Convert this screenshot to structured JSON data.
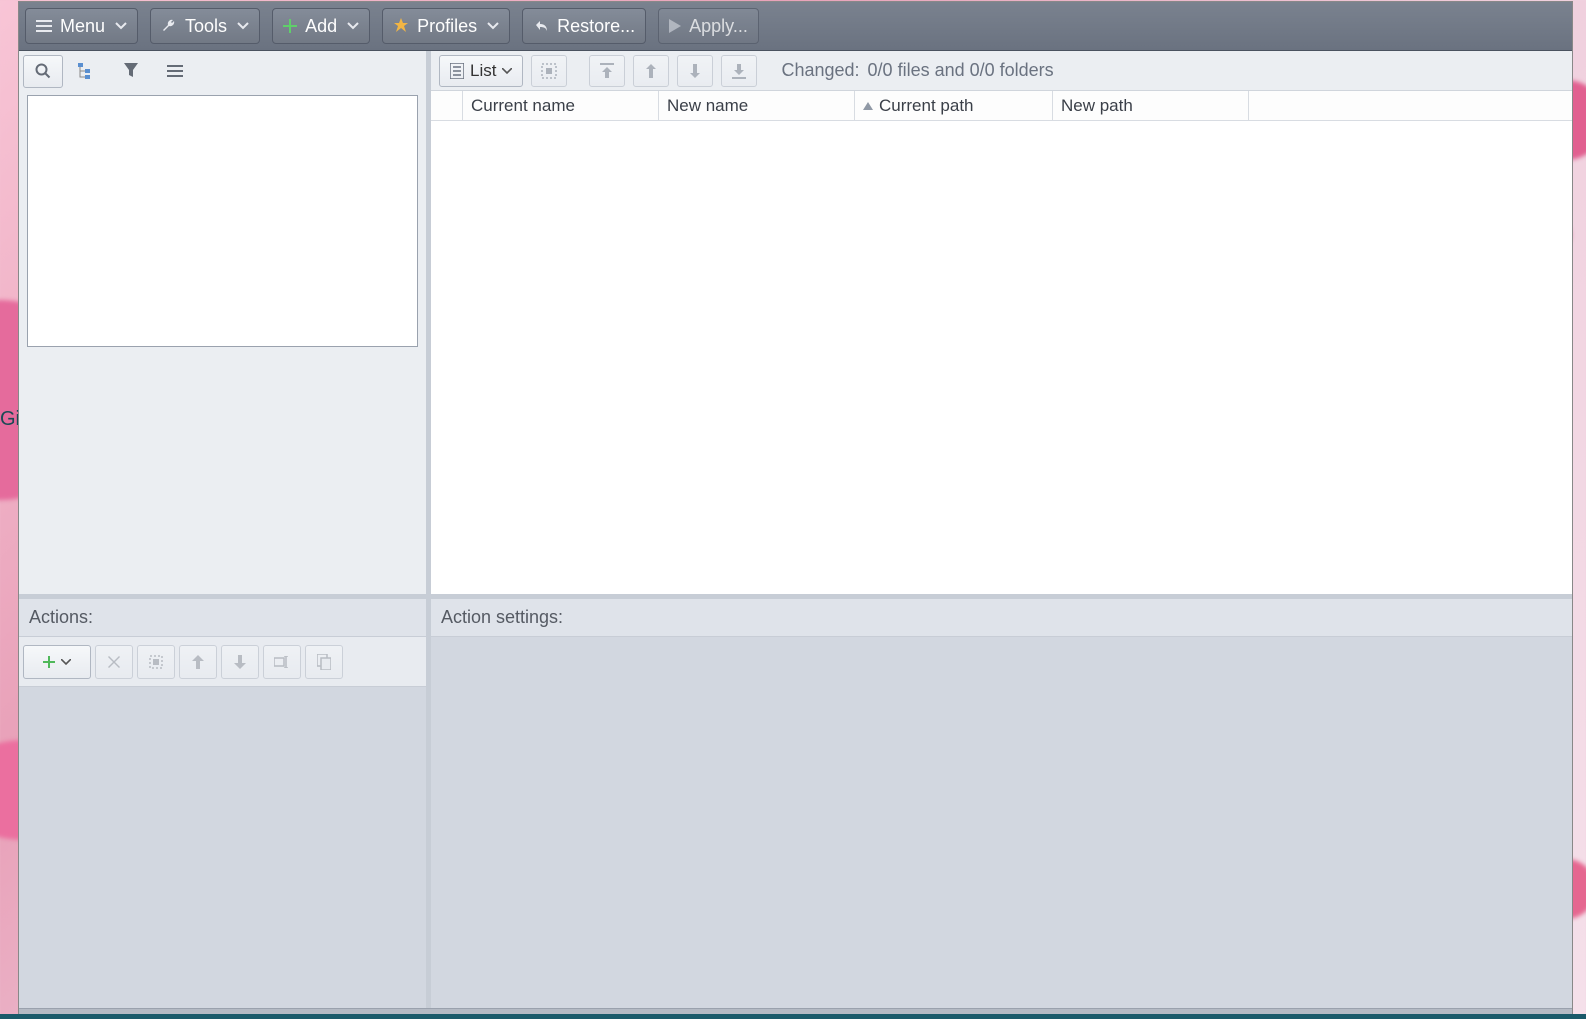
{
  "menubar": {
    "menu_label": "Menu",
    "tools_label": "Tools",
    "add_label": "Add",
    "profiles_label": "Profiles",
    "restore_label": "Restore...",
    "apply_label": "Apply..."
  },
  "right_toolbar": {
    "list_label": "List",
    "changed_label": "Changed:",
    "changed_value": "0/0 files and 0/0 folders"
  },
  "table": {
    "columns": {
      "current_name": "Current name",
      "new_name": "New name",
      "current_path": "Current path",
      "new_path": "New path"
    }
  },
  "bottom": {
    "actions_label": "Actions:",
    "settings_label": "Action settings:"
  },
  "bg": {
    "partial_text": "Gill"
  }
}
